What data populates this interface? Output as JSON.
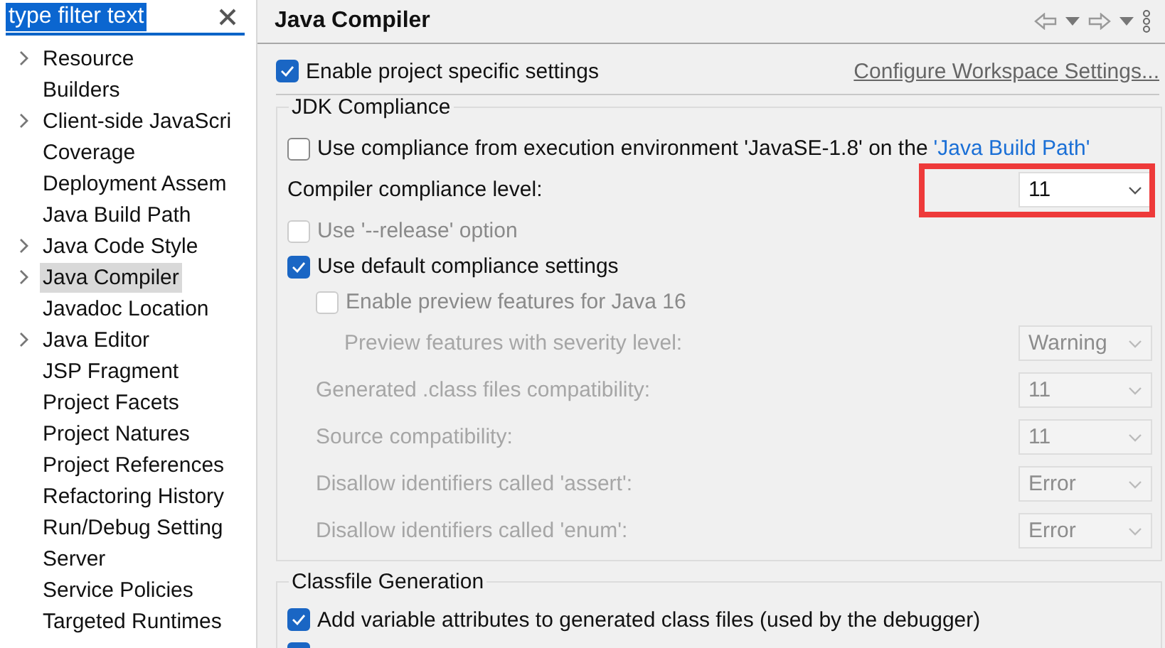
{
  "sidebar": {
    "filter": {
      "value": "type filter text"
    },
    "items": [
      {
        "label": "Resource",
        "kind": "node",
        "selected": false
      },
      {
        "label": "Builders",
        "kind": "leaf",
        "selected": false
      },
      {
        "label": "Client-side JavaScri",
        "kind": "node",
        "selected": false
      },
      {
        "label": "Coverage",
        "kind": "leaf",
        "selected": false
      },
      {
        "label": "Deployment Assem",
        "kind": "leaf",
        "selected": false
      },
      {
        "label": "Java Build Path",
        "kind": "leaf",
        "selected": false
      },
      {
        "label": "Java Code Style",
        "kind": "node",
        "selected": false
      },
      {
        "label": "Java Compiler",
        "kind": "node",
        "selected": true
      },
      {
        "label": "Javadoc Location",
        "kind": "leaf",
        "selected": false
      },
      {
        "label": "Java Editor",
        "kind": "node",
        "selected": false
      },
      {
        "label": "JSP Fragment",
        "kind": "leaf",
        "selected": false
      },
      {
        "label": "Project Facets",
        "kind": "leaf",
        "selected": false
      },
      {
        "label": "Project Natures",
        "kind": "leaf",
        "selected": false
      },
      {
        "label": "Project References",
        "kind": "leaf",
        "selected": false
      },
      {
        "label": "Refactoring History",
        "kind": "leaf",
        "selected": false
      },
      {
        "label": "Run/Debug Setting",
        "kind": "leaf",
        "selected": false
      },
      {
        "label": "Server",
        "kind": "leaf",
        "selected": false
      },
      {
        "label": "Service Policies",
        "kind": "leaf",
        "selected": false
      },
      {
        "label": "Targeted Runtimes",
        "kind": "leaf",
        "selected": false
      }
    ]
  },
  "page": {
    "title": "Java Compiler",
    "enable_project_settings": {
      "label": "Enable project specific settings",
      "checked": true
    },
    "workspace_link": "Configure Workspace Settings...",
    "jdk_compliance": {
      "title": "JDK Compliance",
      "use_execution_env": {
        "label": "Use compliance from execution environment 'JavaSE-1.8' on the",
        "link": "'Java Build Path'",
        "checked": false
      },
      "rows": [
        {
          "kind": "combo",
          "label": "Compiler compliance level:",
          "value": "11",
          "disabled": false,
          "highlighted": true
        },
        {
          "kind": "checkbox",
          "label": "Use '--release' option",
          "checked": false,
          "disabled": true
        },
        {
          "kind": "checkbox",
          "label": "Use default compliance settings",
          "checked": true,
          "disabled": false,
          "children": [
            {
              "kind": "checkbox",
              "label": "Enable preview features for Java 16",
              "checked": false,
              "disabled": true,
              "children": [
                {
                  "kind": "combo",
                  "label": "Preview features with severity level:",
                  "value": "Warning",
                  "disabled": true
                }
              ]
            },
            {
              "kind": "combo",
              "label": "Generated .class files compatibility:",
              "value": "11",
              "disabled": true
            },
            {
              "kind": "combo",
              "label": "Source compatibility:",
              "value": "11",
              "disabled": true
            },
            {
              "kind": "combo",
              "label": "Disallow identifiers called 'assert':",
              "value": "Error",
              "disabled": true
            },
            {
              "kind": "combo",
              "label": "Disallow identifiers called 'enum':",
              "value": "Error",
              "disabled": true
            }
          ]
        }
      ]
    },
    "classfile_generation": {
      "title": "Classfile Generation",
      "options": [
        {
          "label": "Add variable attributes to generated class files (used by the debugger)",
          "checked": true
        },
        {
          "checked": true
        }
      ]
    }
  }
}
